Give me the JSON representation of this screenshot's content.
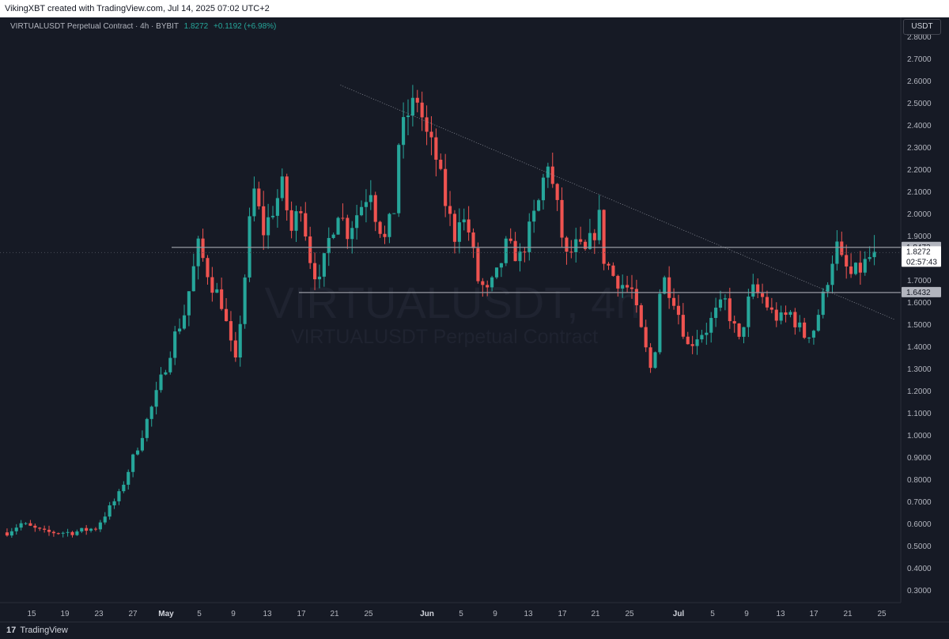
{
  "header": {
    "attribution": "VikingXBT created with TradingView.com, Jul 14, 2025 07:02 UTC+2"
  },
  "legend": {
    "symbol": "VIRTUALUSDT Perpetual Contract · 4h · BYBIT",
    "last": "1.8272",
    "change": "+0.1192 (+6.98%)"
  },
  "currency_button": "USDT",
  "watermark": {
    "big": "VIRTUALUSDT, 4h",
    "small": "VIRTUALUSDT Perpetual Contract"
  },
  "footer": {
    "brand": "TradingView",
    "logo_glyph": "17"
  },
  "price_labels": {
    "resistance": "1.8473",
    "current": "1.8272",
    "countdown": "02:57:43",
    "support": "1.6432"
  },
  "colors": {
    "background": "#161a25",
    "up": "#26a69a",
    "down": "#ef5350",
    "axis_text": "#b2b5be",
    "level_line": "#9598a1"
  },
  "chart_data": {
    "type": "candlestick",
    "y_axis": {
      "ticks": [
        "2.8000",
        "2.7000",
        "2.6000",
        "2.5000",
        "2.4000",
        "2.3000",
        "2.2000",
        "2.1000",
        "2.0000",
        "1.9000",
        "1.8000",
        "1.7000",
        "1.6000",
        "1.5000",
        "1.4000",
        "1.3000",
        "1.2000",
        "1.1000",
        "1.0000",
        "0.9000",
        "0.8000",
        "0.7000",
        "0.6000",
        "0.5000",
        "0.4000",
        "0.3000"
      ],
      "range": [
        0.25,
        2.85
      ]
    },
    "x_axis": {
      "ticks": [
        "15",
        "19",
        "23",
        "27",
        "May",
        "5",
        "9",
        "13",
        "17",
        "21",
        "25",
        "Jun",
        "5",
        "9",
        "13",
        "17",
        "21",
        "25",
        "Jul",
        "5",
        "9",
        "13",
        "17",
        "21",
        "25"
      ],
      "bold": [
        "May",
        "Jun",
        "Jul"
      ]
    },
    "price_path": [
      [
        0,
        0.56
      ],
      [
        3,
        0.6
      ],
      [
        8,
        0.56
      ],
      [
        14,
        0.56
      ],
      [
        19,
        0.58
      ],
      [
        24,
        0.73
      ],
      [
        28,
        0.95
      ],
      [
        32,
        1.18
      ],
      [
        36,
        1.45
      ],
      [
        38,
        1.55
      ],
      [
        40,
        1.75
      ],
      [
        41,
        1.85
      ],
      [
        44,
        1.68
      ],
      [
        46,
        1.6
      ],
      [
        48,
        1.4
      ],
      [
        49,
        1.32
      ],
      [
        51,
        1.72
      ],
      [
        52,
        1.95
      ],
      [
        53,
        2.1
      ],
      [
        55,
        1.92
      ],
      [
        57,
        2.02
      ],
      [
        59,
        2.12
      ],
      [
        61,
        1.92
      ],
      [
        63,
        2.05
      ],
      [
        65,
        1.8
      ],
      [
        67,
        1.68
      ],
      [
        69,
        1.88
      ],
      [
        71,
        2.02
      ],
      [
        73,
        1.92
      ],
      [
        75,
        2.0
      ],
      [
        78,
        2.12
      ],
      [
        79,
        2.0
      ],
      [
        81,
        1.88
      ],
      [
        83,
        2.02
      ],
      [
        84,
        2.32
      ],
      [
        86,
        2.45
      ],
      [
        88,
        2.52
      ],
      [
        90,
        2.35
      ],
      [
        92,
        2.25
      ],
      [
        94,
        2.05
      ],
      [
        96,
        1.9
      ],
      [
        97,
        2.0
      ],
      [
        99,
        1.92
      ],
      [
        101,
        1.7
      ],
      [
        103,
        1.64
      ],
      [
        105,
        1.72
      ],
      [
        107,
        1.85
      ],
      [
        109,
        1.82
      ],
      [
        110,
        1.8
      ],
      [
        112,
        1.92
      ],
      [
        114,
        2.05
      ],
      [
        115,
        2.15
      ],
      [
        116,
        2.24
      ],
      [
        117,
        2.12
      ],
      [
        118,
        2.02
      ],
      [
        119,
        1.9
      ],
      [
        120,
        1.8
      ],
      [
        122,
        1.85
      ],
      [
        124,
        1.82
      ],
      [
        126,
        1.92
      ],
      [
        127,
        1.98
      ],
      [
        128,
        1.8
      ],
      [
        130,
        1.72
      ],
      [
        132,
        1.68
      ],
      [
        134,
        1.65
      ],
      [
        135,
        1.55
      ],
      [
        137,
        1.38
      ],
      [
        138,
        1.3
      ],
      [
        139,
        1.4
      ],
      [
        140,
        1.65
      ],
      [
        141,
        1.7
      ],
      [
        143,
        1.62
      ],
      [
        145,
        1.48
      ],
      [
        146,
        1.4
      ],
      [
        148,
        1.45
      ],
      [
        150,
        1.48
      ],
      [
        152,
        1.55
      ],
      [
        154,
        1.6
      ],
      [
        156,
        1.48
      ],
      [
        157,
        1.42
      ],
      [
        159,
        1.6
      ],
      [
        160,
        1.65
      ],
      [
        162,
        1.62
      ],
      [
        164,
        1.55
      ],
      [
        166,
        1.52
      ],
      [
        168,
        1.55
      ],
      [
        170,
        1.48
      ],
      [
        171,
        1.45
      ],
      [
        173,
        1.48
      ],
      [
        175,
        1.62
      ],
      [
        177,
        1.8
      ],
      [
        178,
        1.85
      ],
      [
        179,
        1.78
      ],
      [
        181,
        1.72
      ],
      [
        183,
        1.75
      ],
      [
        185,
        1.8
      ],
      [
        186,
        1.83
      ]
    ],
    "levels": [
      {
        "name": "resistance",
        "price": 1.8473
      },
      {
        "name": "support",
        "price": 1.6432
      }
    ],
    "trendline": {
      "from": [
        72,
        2.58
      ],
      "to": [
        191,
        1.52
      ]
    },
    "last_price": 1.8272
  }
}
